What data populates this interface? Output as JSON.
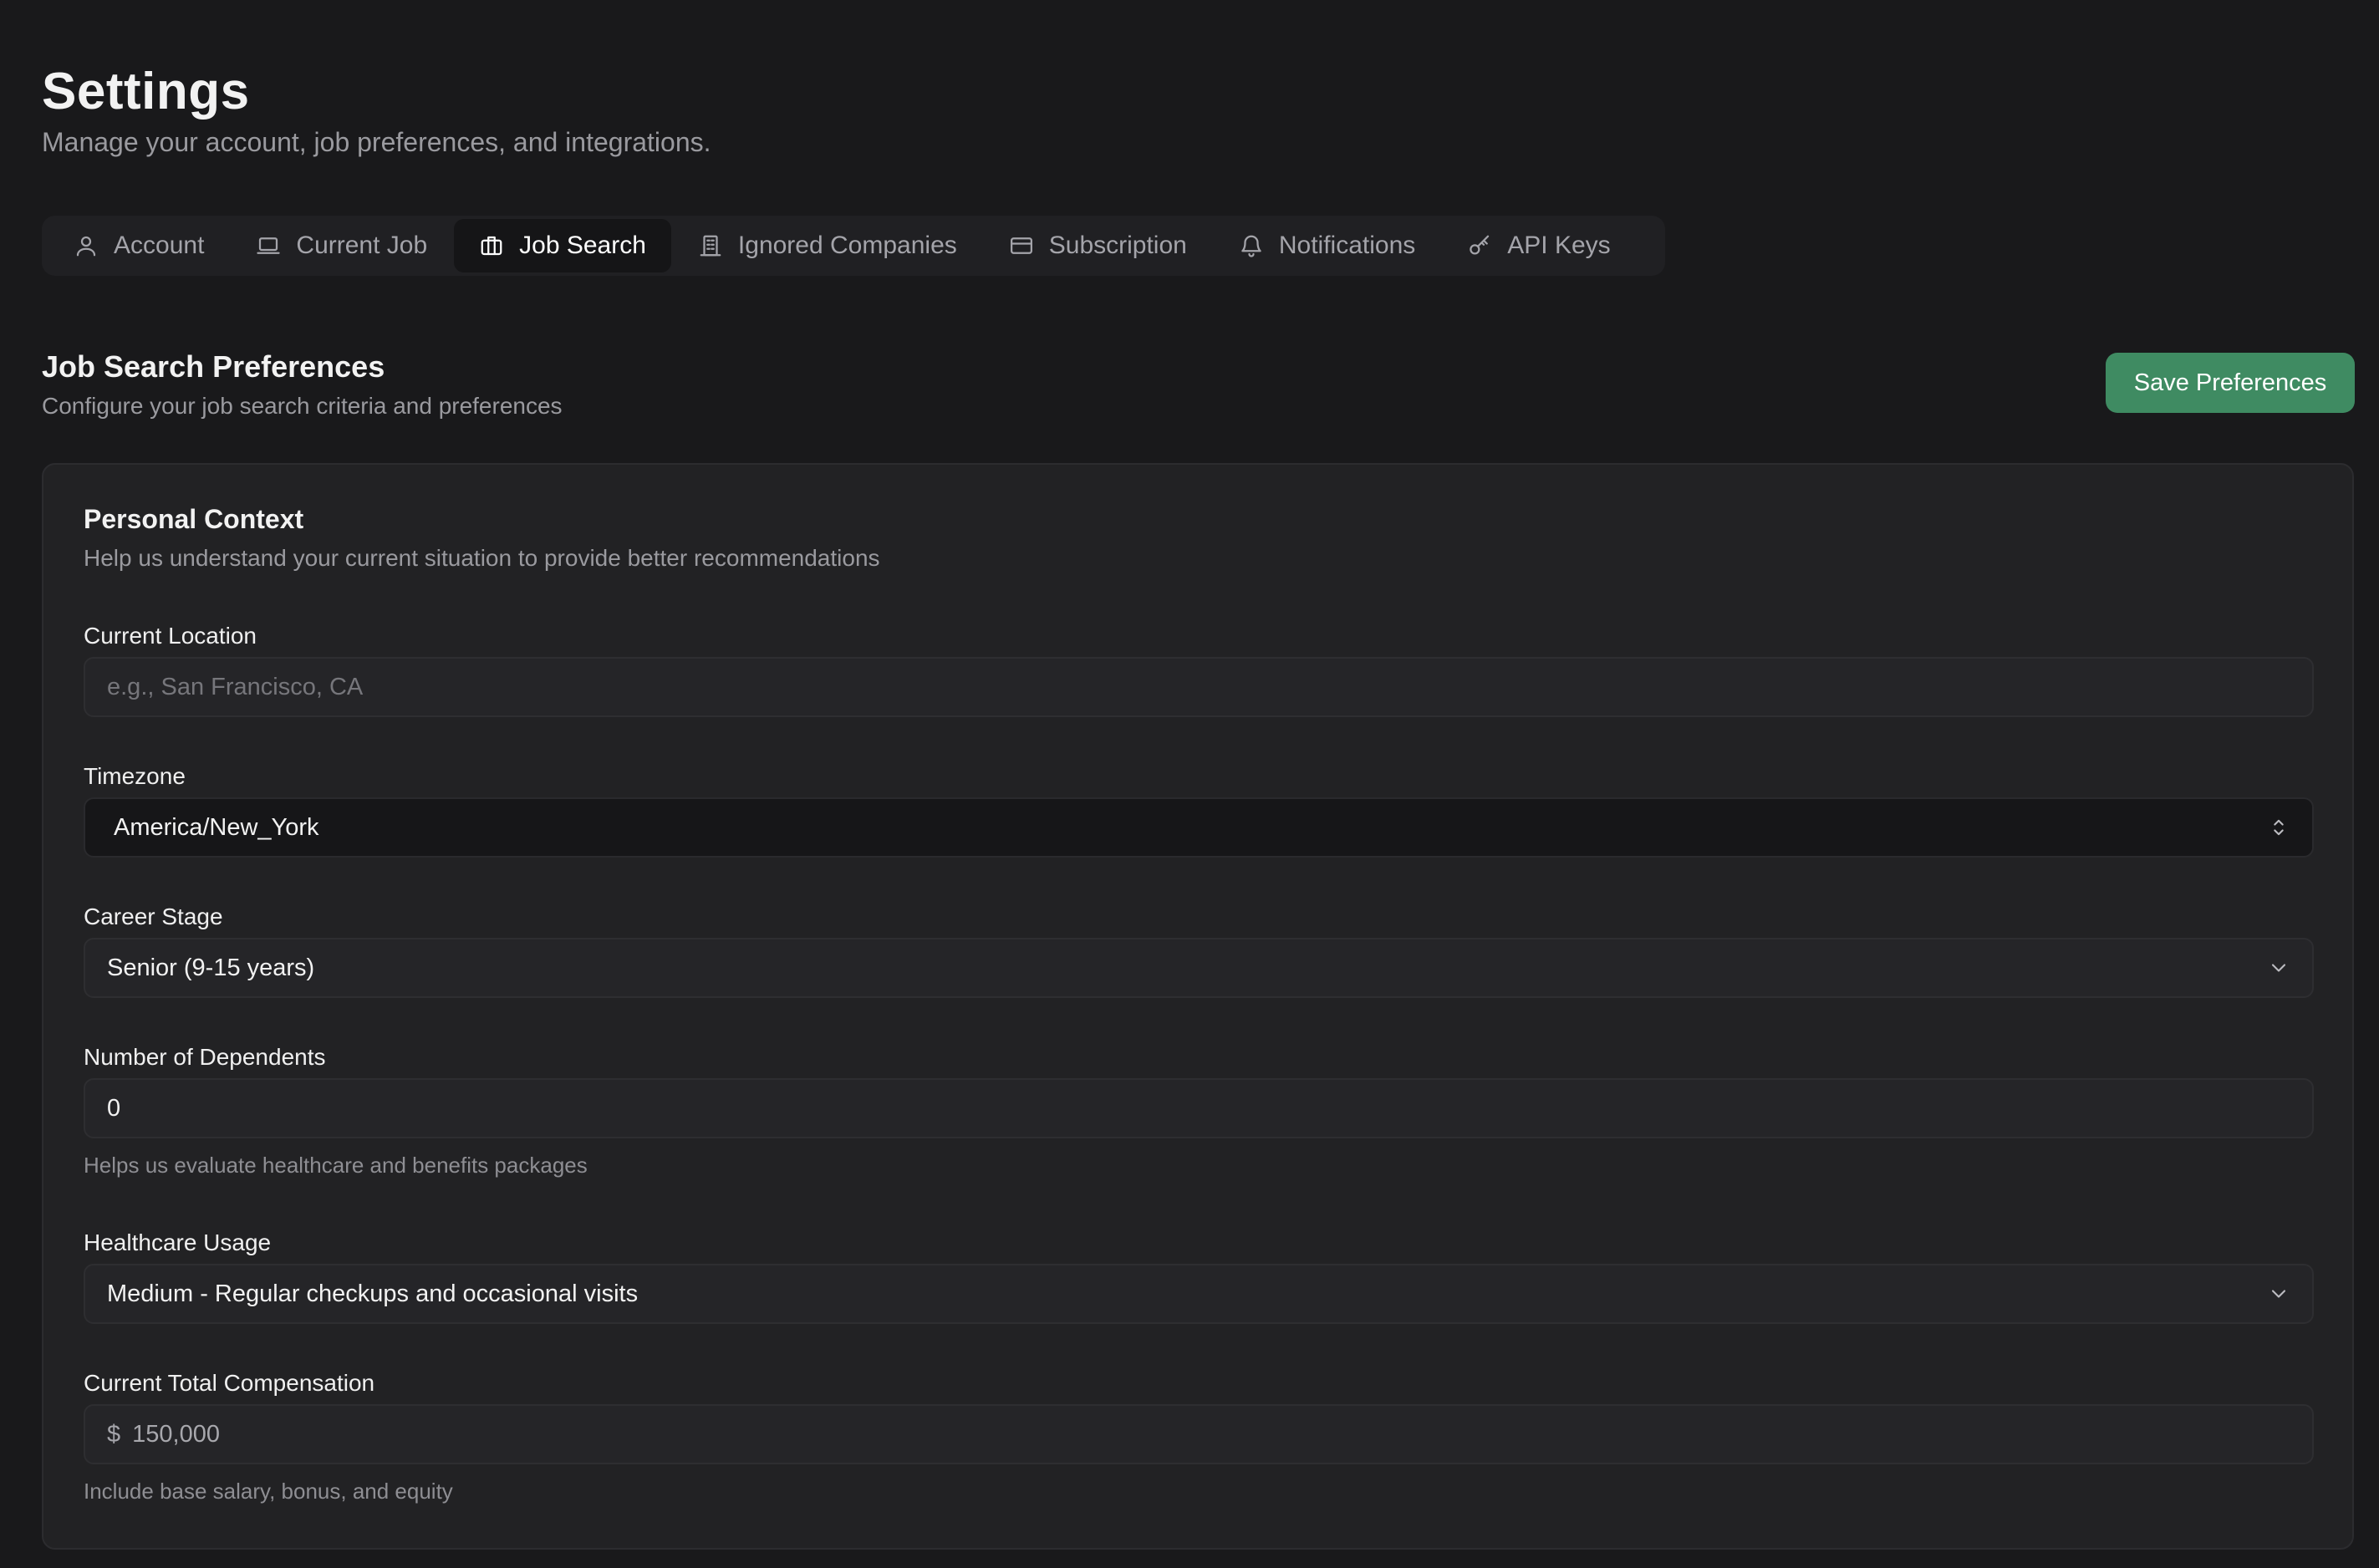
{
  "header": {
    "title": "Settings",
    "subtitle": "Manage your account, job preferences, and integrations."
  },
  "tabs": [
    {
      "label": "Account",
      "icon": "user-icon"
    },
    {
      "label": "Current Job",
      "icon": "laptop-icon"
    },
    {
      "label": "Job Search",
      "icon": "briefcase-icon",
      "active": true
    },
    {
      "label": "Ignored Companies",
      "icon": "building-icon"
    },
    {
      "label": "Subscription",
      "icon": "credit-card-icon"
    },
    {
      "label": "Notifications",
      "icon": "bell-icon"
    },
    {
      "label": "API Keys",
      "icon": "key-icon"
    }
  ],
  "section": {
    "title": "Job Search Preferences",
    "subtitle": "Configure your job search criteria and preferences",
    "save_label": "Save Preferences"
  },
  "card": {
    "title": "Personal Context",
    "subtitle": "Help us understand your current situation to provide better recommendations",
    "location": {
      "label": "Current Location",
      "placeholder": "e.g., San Francisco, CA",
      "value": ""
    },
    "timezone": {
      "label": "Timezone",
      "value": "America/New_York"
    },
    "career_stage": {
      "label": "Career Stage",
      "value": "Senior (9-15 years)"
    },
    "dependents": {
      "label": "Number of Dependents",
      "value": "0",
      "hint": "Helps us evaluate healthcare and benefits packages"
    },
    "healthcare": {
      "label": "Healthcare Usage",
      "value": "Medium - Regular checkups and occasional visits"
    },
    "compensation": {
      "label": "Current Total Compensation",
      "currency": "$",
      "value": "150,000",
      "hint": "Include base salary, bonus, and equity"
    }
  },
  "colors": {
    "background": "#19191b",
    "card": "#222224",
    "accent": "#3f8b62",
    "muted_text": "#9a9a9f"
  }
}
